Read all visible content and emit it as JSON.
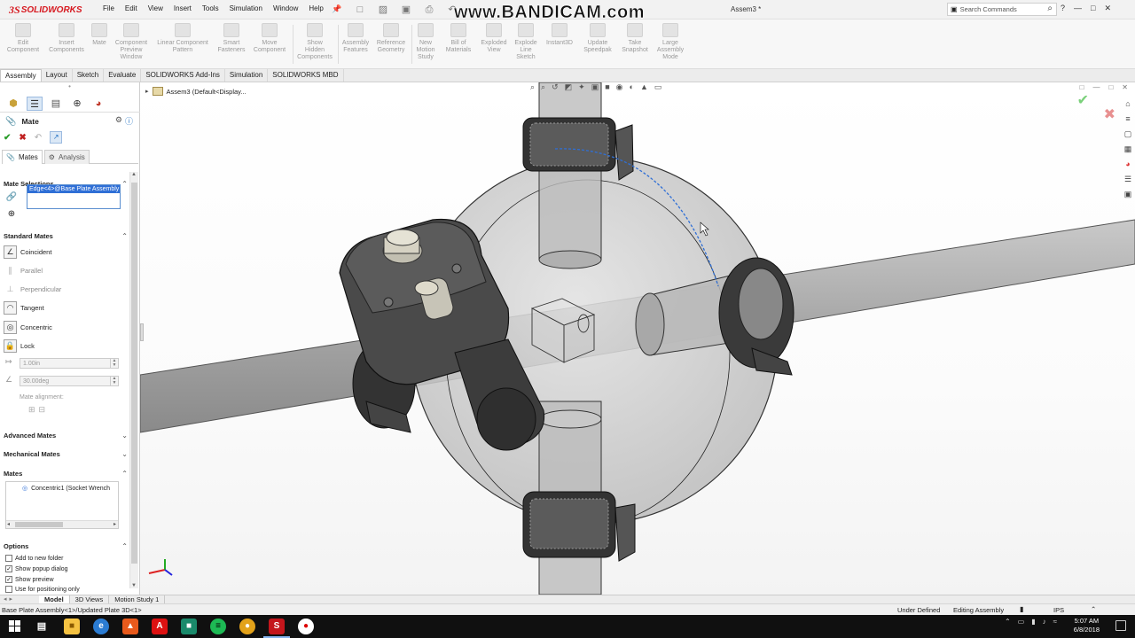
{
  "app": {
    "logo_ds": "3S",
    "logo_text": "SOLIDWORKS",
    "document_title": "Assem3 *",
    "watermark": "www.BANDICAM.com",
    "search_placeholder": "Search Commands"
  },
  "menu": [
    "File",
    "Edit",
    "View",
    "Insert",
    "Tools",
    "Simulation",
    "Window",
    "Help"
  ],
  "command_manager": [
    "Edit\nComponent",
    "Insert\nComponents",
    "Mate",
    "Component\nPreview\nWindow",
    "Linear Component\nPattern",
    "Smart\nFasteners",
    "Move\nComponent",
    "Show\nHidden\nComponents",
    "Assembly\nFeatures",
    "Reference\nGeometry",
    "New\nMotion\nStudy",
    "Bill of\nMaterials",
    "Exploded\nView",
    "Explode\nLine\nSketch",
    "Instant3D",
    "Update\nSpeedpak",
    "Take\nSnapshot",
    "Large\nAssembly\nMode"
  ],
  "tabs": [
    "Assembly",
    "Layout",
    "Sketch",
    "Evaluate",
    "SOLIDWORKS Add-Ins",
    "Simulation",
    "SOLIDWORKS MBD"
  ],
  "active_tab": "Assembly",
  "property_manager": {
    "title": "Mate",
    "subtabs": [
      "Mates",
      "Analysis"
    ],
    "mate_selections_label": "Mate Selections",
    "selection_item": "Edge<4>@Base Plate Assembly",
    "standard_mates_label": "Standard Mates",
    "standard_mates": [
      {
        "label": "Coincident",
        "enabled": true
      },
      {
        "label": "Parallel",
        "enabled": false
      },
      {
        "label": "Perpendicular",
        "enabled": false
      },
      {
        "label": "Tangent",
        "enabled": true
      },
      {
        "label": "Concentric",
        "enabled": true
      },
      {
        "label": "Lock",
        "enabled": true
      }
    ],
    "distance_value": "1.00in",
    "angle_value": "30.00deg",
    "mate_alignment_label": "Mate alignment:",
    "advanced_mates_label": "Advanced Mates",
    "mechanical_mates_label": "Mechanical Mates",
    "mates_label": "Mates",
    "mates_list": [
      "Concentric1 (Socket Wrench"
    ],
    "options_label": "Options",
    "options": [
      {
        "label": "Add to new folder",
        "checked": false
      },
      {
        "label": "Show popup dialog",
        "checked": true
      },
      {
        "label": "Show preview",
        "checked": true
      },
      {
        "label": "Use for positioning only",
        "checked": false
      }
    ]
  },
  "graphics": {
    "tree_root": "Assem3  (Default<Display..."
  },
  "bottom_tabs": [
    "Model",
    "3D Views",
    "Motion Study 1"
  ],
  "status": {
    "left": "Base Plate Assembly<1>/Updated Plate 3D<1>",
    "state": "Under Defined",
    "mode": "Editing Assembly",
    "units": "IPS"
  },
  "taskbar": {
    "time": "5:07 AM",
    "date": "6/8/2018"
  }
}
